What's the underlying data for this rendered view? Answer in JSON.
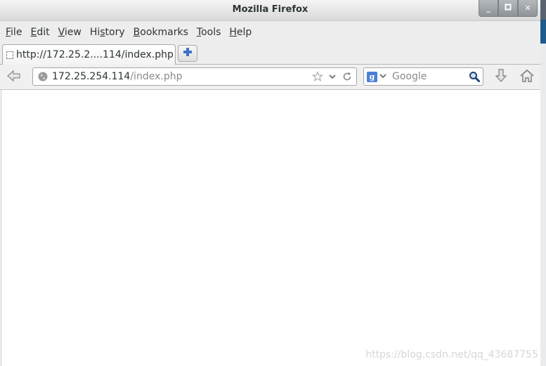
{
  "window": {
    "title": "Mozilla Firefox",
    "controls": {
      "minimize": "_",
      "maximize": "▫",
      "close": "✕"
    }
  },
  "menubar": {
    "items": [
      {
        "accel": "F",
        "rest": "ile"
      },
      {
        "accel": "E",
        "rest": "dit"
      },
      {
        "accel": "V",
        "rest": "iew"
      },
      {
        "pre": "Hi",
        "accel": "s",
        "rest": "tory"
      },
      {
        "accel": "B",
        "rest": "ookmarks"
      },
      {
        "accel": "T",
        "rest": "ools"
      },
      {
        "accel": "H",
        "rest": "elp"
      }
    ]
  },
  "tabs": [
    {
      "label": "http://172.25.2....114/index.php",
      "active": true
    }
  ],
  "navbar": {
    "url_host": "172.25.254.114",
    "url_path": "/index.php",
    "search_engine": "Google",
    "search_placeholder": "Google"
  },
  "icons": {
    "back": "back-arrow-icon",
    "globe": "globe-icon",
    "bookmark": "star-icon",
    "dropdown": "chevron-down-icon",
    "reload": "reload-icon",
    "search": "magnifier-icon",
    "download": "download-arrow-icon",
    "home": "home-icon",
    "new_tab": "plus-icon"
  },
  "colors": {
    "accent": "#4a7fd6",
    "new_tab_plus": "#3d72c4",
    "desktop_blue": "#1f5a8c"
  },
  "watermark": "https://blog.csdn.net/qq_43687755"
}
